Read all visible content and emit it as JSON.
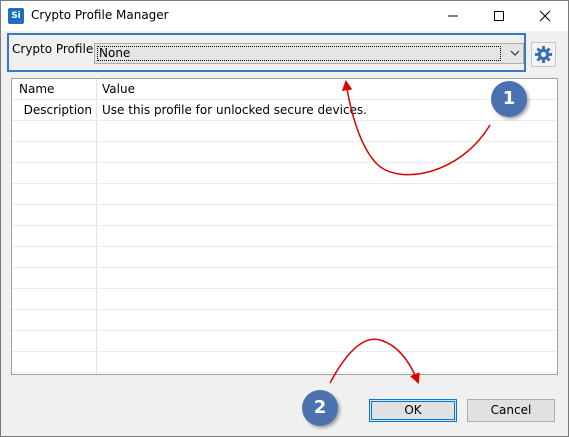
{
  "window": {
    "title": "Crypto Profile Manager",
    "app_icon": "Si"
  },
  "profile": {
    "label": "Crypto Profile:",
    "selected": "None"
  },
  "table": {
    "columns": [
      "Name",
      "Value"
    ],
    "rows": [
      {
        "name": "Description",
        "value": "Use this profile for unlocked secure devices."
      }
    ]
  },
  "buttons": {
    "ok": "OK",
    "cancel": "Cancel"
  },
  "annotations": {
    "step1": "1",
    "step2": "2"
  },
  "colors": {
    "highlight_border": "#3a78c2",
    "badge": "#4a72b0",
    "arrow": "#e00000"
  },
  "icons": [
    "app-icon",
    "minimize-icon",
    "maximize-icon",
    "close-icon",
    "chevron-down-icon",
    "gear-icon"
  ]
}
